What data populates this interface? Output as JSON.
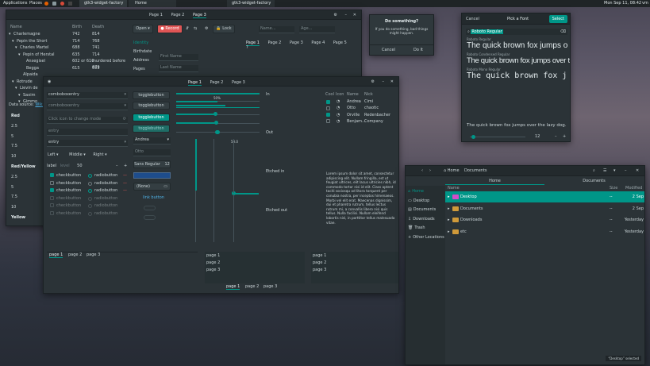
{
  "panel": {
    "applications": "Applications",
    "places": "Places",
    "tasks": [
      "gtk3-widget-factory",
      "Home",
      "gtk3-widget-factory"
    ],
    "clock": "Mon Sep 11, 08:42",
    "user": "vm"
  },
  "main": {
    "tabs": [
      "Page 1",
      "Page 2",
      "Page 3"
    ],
    "tree_headers": [
      "Name",
      "Birth",
      "Death"
    ],
    "tree_rows": [
      {
        "name": "Charlemagne",
        "birth": "742",
        "death": "814",
        "lvl": 0
      },
      {
        "name": "Pepin the Short",
        "birth": "714",
        "death": "768",
        "lvl": 1
      },
      {
        "name": "Charles Martel",
        "birth": "688",
        "death": "741",
        "lvl": 2
      },
      {
        "name": "Pepin of Herstal",
        "birth": "635",
        "death": "714",
        "lvl": 3
      },
      {
        "name": "Ansegisel",
        "birth": "602 or 610",
        "death": "murdered before 679",
        "lvl": 4
      },
      {
        "name": "Begga",
        "birth": "615",
        "death": "693",
        "lvl": 4
      },
      {
        "name": "Alpaida",
        "birth": "",
        "death": "",
        "lvl": 3
      },
      {
        "name": "Rotrude",
        "birth": "",
        "death": "",
        "lvl": 1
      },
      {
        "name": "Lievin de",
        "birth": "",
        "death": "",
        "lvl": 2
      },
      {
        "name": "Saxim",
        "birth": "",
        "death": "",
        "lvl": 3
      },
      {
        "name": "Gimmo",
        "birth": "",
        "death": "",
        "lvl": 3
      }
    ],
    "data_source": "Data source:",
    "wikipedia": "Wikipedia",
    "color_list": [
      "Red",
      "2.5",
      "5",
      "7.5",
      "10",
      "Red/Yellow",
      "2.5",
      "5",
      "7.5",
      "10",
      "Yellow"
    ],
    "open": "Open",
    "record": "Record",
    "lock": "Lock",
    "sidebar": [
      "Identity",
      "Birthdate",
      "Address",
      "Pages"
    ],
    "name_placeholder": "Name...",
    "age_placeholder": "Age...",
    "first_name": "First Name",
    "last_name": "Last Name",
    "page_tabs": [
      "Page 1",
      "Page 2",
      "Page 3",
      "Page 4",
      "Page 5"
    ]
  },
  "dialog": {
    "title": "Do something?",
    "body": "If you do something, bad things might happen.",
    "cancel": "Cancel",
    "do_it": "Do It"
  },
  "font": {
    "cancel": "Cancel",
    "title": "Pick a Font",
    "select": "Select",
    "search": "Roboto Regular",
    "fonts": [
      {
        "name": "Roboto Regular",
        "sample": "The quick brown fox jumps o"
      },
      {
        "name": "Roboto Condensed Regular",
        "sample": "The quick brown fox jumps over t"
      },
      {
        "name": "Roboto Mono Regular",
        "sample": "The quick brown fox j"
      }
    ],
    "preview": "The quick brown fox jumps over the lazy dog.",
    "size": "12"
  },
  "widgets": {
    "tabs": [
      "Page 1",
      "Page 2",
      "Page 3"
    ],
    "combo1": "comboboxentry",
    "combo2": "comboboxentry",
    "icon_field": "Click icon to change mode",
    "entry1": "entry",
    "entry2": "entry",
    "left": "Left",
    "middle": "Middle",
    "right": "Right",
    "label": "label",
    "level": "level",
    "spin": "50",
    "check": "checkbutton",
    "radio": "radiobutton",
    "toggle": "togglebutton",
    "andrea": "Andrea",
    "otto": "Otto",
    "sans": "Sans Regular",
    "sans_size": "12",
    "none": "(None)",
    "link": "link button",
    "progress": "50%",
    "scale": "50.0",
    "in": "In",
    "out": "Out",
    "etched_in": "Etched in",
    "etched_out": "Etched out",
    "list_headers": [
      "Cool",
      "Icon",
      "Name",
      "Nick"
    ],
    "list_rows": [
      {
        "name": "Andrea",
        "nick": "Cimi",
        "on": true
      },
      {
        "name": "Otto",
        "nick": "chaotic",
        "on": false
      },
      {
        "name": "Orville",
        "nick": "Redenbacher",
        "on": true
      },
      {
        "name": "Benjam...",
        "nick": "Company",
        "on": false
      }
    ],
    "lorem": "Lorem ipsum dolor sit amet, consectetur adipiscing elit. Nullam fringilla, est ut feugiat ultrices, elit lacus ultricies nibh, id commodo tortor nisi id elit. Class aptent taciti sociosqu ad litora torquent per conubia nostra, per inceptos himenaeos. Morbi vel elit erat. Maecenas dignissim, dui et pharetra rutrum, tellus lectus rutrum mi, a convallis libero nisi quis tellus. Nulla facilisi. Nullam eleifend lobortis nisl, in porttitor tellus malesuada vitae.",
    "bottom_tabs": [
      "page 1",
      "page 2",
      "page 3"
    ],
    "side_tabs": [
      "page 1",
      "page 2",
      "page 3"
    ],
    "foot_tabs": [
      "page 1",
      "page 2",
      "page 3"
    ]
  },
  "files": {
    "home": "Home",
    "documents": "Documents",
    "path_home": "Home",
    "path_docs": "Documents",
    "places": [
      "Home",
      "Desktop",
      "Documents",
      "Downloads",
      "Trash",
      "Other Locations"
    ],
    "headers": [
      "Name",
      "Size",
      "Modified"
    ],
    "rows": [
      {
        "name": "Desktop",
        "size": "--",
        "mod": "2 Sep"
      },
      {
        "name": "Documents",
        "size": "--",
        "mod": "2 Sep"
      },
      {
        "name": "Downloads",
        "size": "--",
        "mod": "Yesterday"
      },
      {
        "name": "etc",
        "size": "--",
        "mod": "Yesterday"
      }
    ],
    "status": "“Desktop” selected"
  }
}
